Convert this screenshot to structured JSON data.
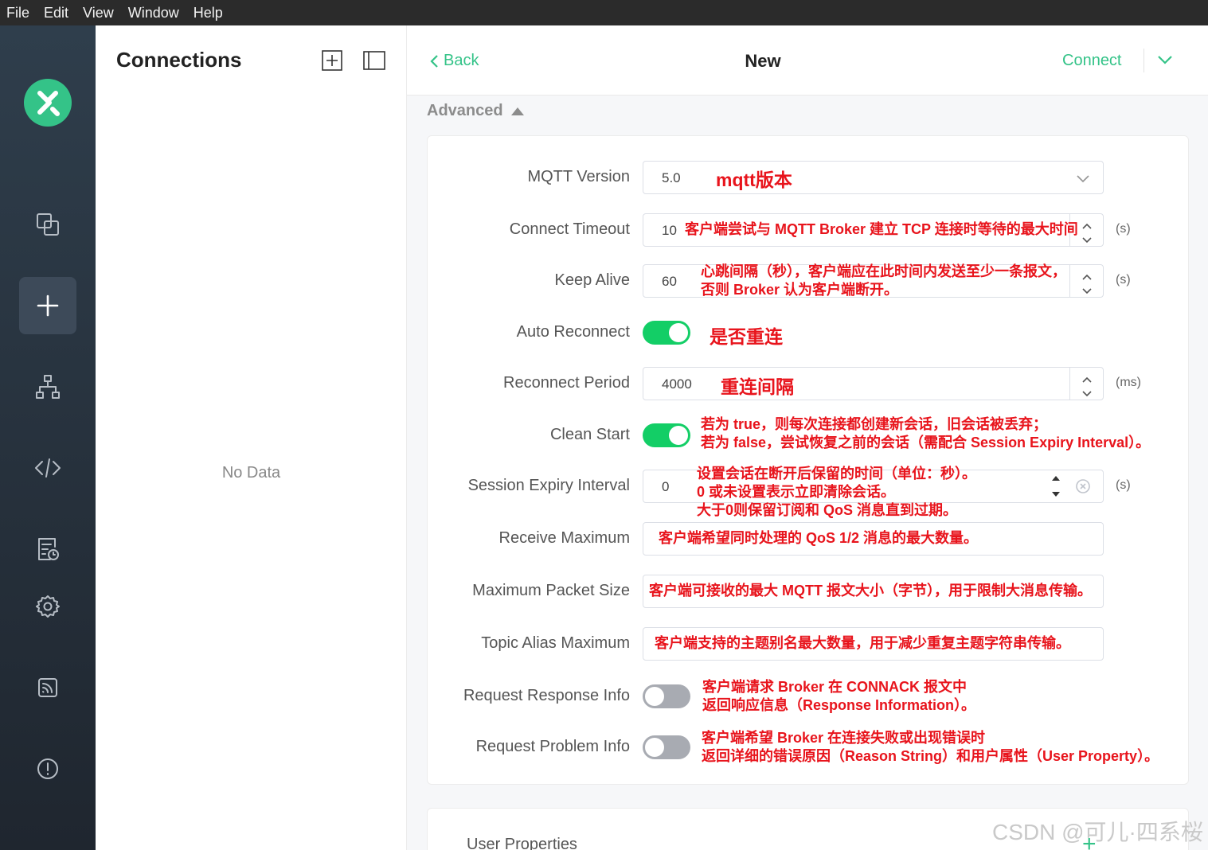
{
  "menu": [
    "File",
    "Edit",
    "View",
    "Window",
    "Help"
  ],
  "sidebar": {
    "icons": [
      "connections-icon",
      "new-connection-icon",
      "topology-icon",
      "script-icon",
      "log-icon",
      "settings-icon",
      "subscription-icon",
      "about-icon"
    ],
    "active": "new-connection-icon"
  },
  "connections": {
    "title": "Connections",
    "empty_text": "No Data"
  },
  "header": {
    "back_label": "Back",
    "title": "New",
    "connect_label": "Connect"
  },
  "advanced": {
    "title": "Advanced",
    "fields": {
      "mqtt_version": {
        "label": "MQTT Version",
        "value": "5.0",
        "note": "mqtt版本"
      },
      "connect_timeout": {
        "label": "Connect Timeout",
        "value": "10",
        "unit": "(s)",
        "note": "客户端尝试与 MQTT Broker 建立 TCP 连接时等待的最大时间"
      },
      "keep_alive": {
        "label": "Keep Alive",
        "value": "60",
        "unit": "(s)",
        "note_line1": "心跳间隔（秒），客户端应在此时间内发送至少一条报文，",
        "note_line2": "否则 Broker 认为客户端断开。"
      },
      "auto_reconnect": {
        "label": "Auto Reconnect",
        "enabled": true,
        "note": "是否重连"
      },
      "reconnect_period": {
        "label": "Reconnect Period",
        "value": "4000",
        "unit": "(ms)",
        "note": "重连间隔"
      },
      "clean_start": {
        "label": "Clean Start",
        "enabled": true,
        "note_line1": "若为 true，则每次连接都创建新会话，旧会话被丢弃；",
        "note_line2": "若为 false，尝试恢复之前的会话（需配合 Session Expiry Interval）。"
      },
      "session_expiry": {
        "label": "Session Expiry Interval",
        "value": "0",
        "unit": "(s)",
        "note_line1": "设置会话在断开后保留的时间（单位：秒）。",
        "note_line2": "0 或未设置表示立即清除会话。",
        "note_line3": "大于0则保留订阅和 QoS 消息直到过期。"
      },
      "receive_maximum": {
        "label": "Receive Maximum",
        "note": "客户端希望同时处理的 QoS 1/2 消息的最大数量。"
      },
      "max_packet_size": {
        "label": "Maximum Packet Size",
        "note": "客户端可接收的最大 MQTT 报文大小（字节），用于限制大消息传输。"
      },
      "topic_alias_max": {
        "label": "Topic Alias Maximum",
        "note": "客户端支持的主题别名最大数量，用于减少重复主题字符串传输。"
      },
      "request_response_info": {
        "label": "Request Response Info",
        "enabled": false,
        "note_line1": "客户端请求 Broker 在 CONNACK 报文中",
        "note_line2": "返回响应信息（Response Information）。"
      },
      "request_problem_info": {
        "label": "Request Problem Info",
        "enabled": false,
        "note_line1": "客户端希望 Broker 在连接失败或出现错误时",
        "note_line2": "返回详细的错误原因（Reason String）和用户属性（User Property）。"
      }
    }
  },
  "user_properties": {
    "label": "User Properties"
  },
  "watermark": "CSDN @可儿·四系桜",
  "colors": {
    "accent": "#34c388",
    "toggle_on": "#13ce66",
    "annotation": "#e8141c"
  }
}
